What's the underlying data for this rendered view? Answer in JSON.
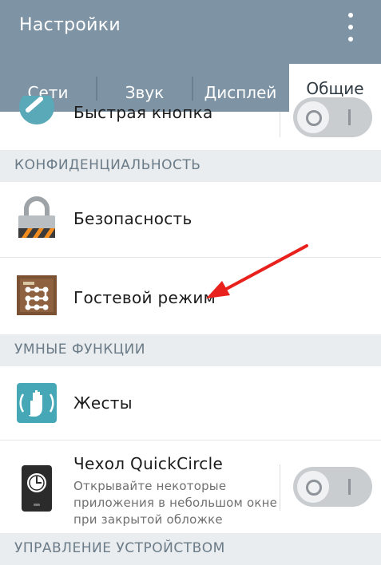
{
  "app": {
    "title": "Настройки"
  },
  "tabs": [
    {
      "label": "Сети"
    },
    {
      "label": "Звук"
    },
    {
      "label": "Дисплей"
    },
    {
      "label": "Общие",
      "active": true
    }
  ],
  "rows": {
    "quick_button": {
      "title": "Быстрая кнопка",
      "toggle_on": false
    },
    "security": {
      "title": "Безопасность"
    },
    "guest_mode": {
      "title": "Гостевой режим"
    },
    "gestures": {
      "title": "Жесты"
    },
    "quickcircle": {
      "title": "Чехол QuickCircle",
      "subtitle_lines": [
        "Открывайте некоторые",
        "приложения в небольшом окне",
        "при закрытой обложке"
      ],
      "toggle_on": false
    }
  },
  "sections": {
    "privacy": "КОНФИДЕНЦИАЛЬНОСТЬ",
    "smart": "УМНЫЕ ФУНКЦИИ",
    "device": "УПРАВЛЕНИЕ УСТРОЙСТВОМ"
  },
  "colors": {
    "appbar": "#7e94a4",
    "accent_arrow": "#e8211c",
    "section_bg": "#e9edef"
  },
  "icons": {
    "quick_button": "quick-button-icon",
    "security": "padlock-icon",
    "guest_mode": "guest-door-icon",
    "gestures": "hand-gesture-icon",
    "quickcircle": "quickcircle-case-icon"
  }
}
